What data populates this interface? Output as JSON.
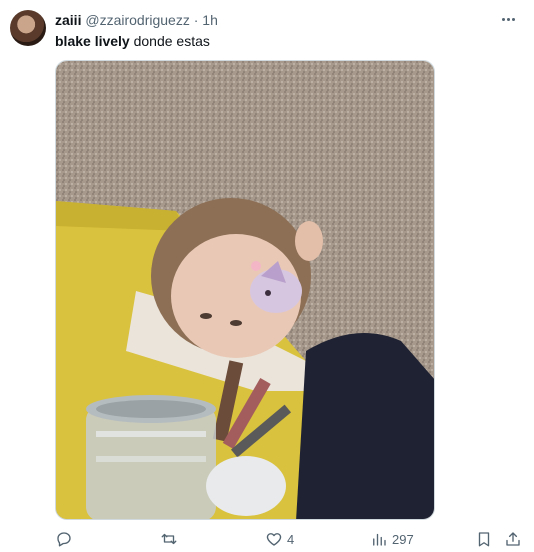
{
  "tweet": {
    "display_name": "zaiii",
    "handle": "@zzairodriguezz",
    "separator": "·",
    "time": "1h",
    "text_bold": "blake lively",
    "text_rest": " donde estas"
  },
  "media": {
    "icon": "photo"
  },
  "actions": {
    "reply_icon": "reply-icon",
    "retweet_icon": "retweet-icon",
    "like_icon": "heart-icon",
    "like_count": "4",
    "views_icon": "views-bar-chart-icon",
    "views_count": "297",
    "bookmark_icon": "bookmark-icon",
    "share_icon": "share-icon"
  },
  "colors": {
    "text_primary": "#0f1419",
    "text_secondary": "#536471",
    "border": "#cfd9de"
  }
}
